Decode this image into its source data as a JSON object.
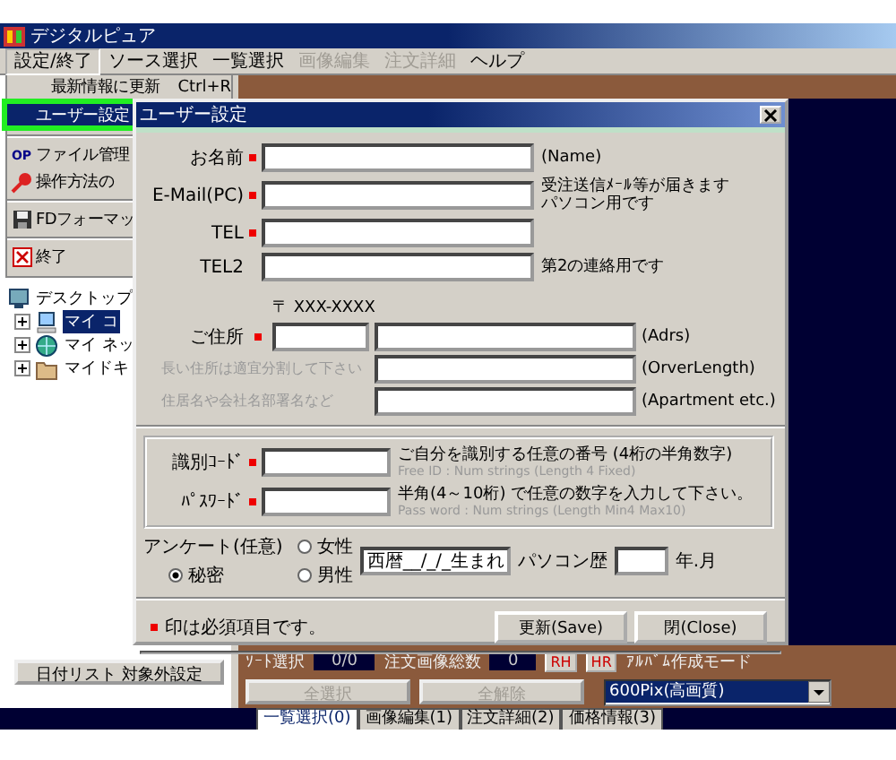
{
  "app": {
    "title": "デジタルピュア"
  },
  "menu": [
    {
      "label": "設定/終了",
      "disabled": false,
      "selected": true
    },
    {
      "label": "ソース選択",
      "disabled": false,
      "selected": false
    },
    {
      "label": "一覧選択",
      "disabled": false,
      "selected": false
    },
    {
      "label": "画像編集",
      "disabled": true,
      "selected": false
    },
    {
      "label": "注文詳細",
      "disabled": true,
      "selected": false
    },
    {
      "label": "ヘルプ",
      "disabled": false,
      "selected": false
    }
  ],
  "dropdown": [
    {
      "kind": "plain",
      "label": "最新情報に更新",
      "shortcut": "Ctrl+R",
      "selected": false,
      "separator_after": false
    },
    {
      "kind": "plain",
      "label": "ユーザー設定",
      "selected": true,
      "separator_after": true
    },
    {
      "kind": "badge",
      "badge": "OP",
      "label": "ファイル管理",
      "selected": false,
      "separator_after": false
    },
    {
      "kind": "key",
      "label": "操作方法の",
      "selected": false,
      "separator_after": true
    },
    {
      "kind": "disk",
      "label": "FDフォーマッ",
      "selected": false,
      "separator_after": true
    },
    {
      "kind": "exit",
      "label": "終了",
      "selected": false,
      "separator_after": false
    }
  ],
  "tree": [
    {
      "kind": "desktop",
      "label": "デスクトップ",
      "selected": false,
      "children": [
        {
          "kind": "computer",
          "label": "マイ コ",
          "selected": true
        },
        {
          "kind": "network",
          "label": "マイ ネッ",
          "selected": false
        },
        {
          "kind": "documents",
          "label": "マイドキ",
          "selected": false
        }
      ]
    }
  ],
  "left_button": "日付リスト 対象外設定",
  "dialog": {
    "title": "ユーザー設定",
    "contacts": [
      {
        "label": "お名前",
        "required": true,
        "note": [
          "(Name)"
        ]
      },
      {
        "label": "E-Mail(PC)",
        "required": true,
        "note": [
          "受注送信ﾒｰﾙ等が届きます",
          "パソコン用です"
        ]
      },
      {
        "label": "TEL",
        "required": true
      },
      {
        "label": "TEL2",
        "required": false,
        "note": [
          "第2の連絡用です"
        ]
      }
    ],
    "address": {
      "zip_hint": "〒 XXX-XXXX",
      "label": "ご住所",
      "required": true,
      "note": "(Adrs)",
      "lines": [
        {
          "hint": "長い住所は適宜分割して下さい",
          "note": "(OrverLength)"
        },
        {
          "hint": "住居名や会社名部署名など",
          "note": "(Apartment etc.)"
        }
      ]
    },
    "credentials": [
      {
        "label": "識別ｺｰﾄﾞ",
        "required": true,
        "note": "ご自分を識別する任意の番号 (4桁の半角数字)",
        "hint": "Free ID : Num strings (Length 4 Fixed)"
      },
      {
        "label": "ﾊﾟｽﾜｰﾄﾞ",
        "required": true,
        "note": "半角(4～10桁) で任意の数字を入力して下さい。",
        "hint": "Pass word : Num strings (Length Min4 Max10)"
      }
    ],
    "survey": {
      "label": "アンケート(任意)",
      "options": [
        {
          "label": "秘密",
          "selected": true
        },
        {
          "label": "女性",
          "selected": false
        },
        {
          "label": "男性",
          "selected": false
        }
      ],
      "birth_value": "西暦__/_/_生まれ",
      "pc_label": "パソコン歴",
      "pc_unit": "年.月"
    },
    "required_note": "印は必須項目です。",
    "buttons": [
      "更新(Save)",
      "閉(Close)"
    ]
  },
  "bottom_panel": {
    "sort_label": "ｿｰﾄ選択",
    "sort_count": "0/0",
    "total_label": "注文画像総数",
    "total_count": "0",
    "small_buttons": [
      "RH",
      "HR"
    ],
    "mode_label": "ｱﾙﾊﾞﾑ作成モード",
    "actions": [
      {
        "label": "全選択",
        "disabled": true
      },
      {
        "label": "全解除",
        "disabled": true
      }
    ],
    "mode_value": "600Pix(高画質)"
  },
  "tabs": [
    {
      "label": "一覧選択(0)",
      "selected": true
    },
    {
      "label": "画像編集(1)",
      "selected": false
    },
    {
      "label": "注文詳細(2)",
      "selected": false
    },
    {
      "label": "価格情報(3)",
      "selected": false
    }
  ]
}
